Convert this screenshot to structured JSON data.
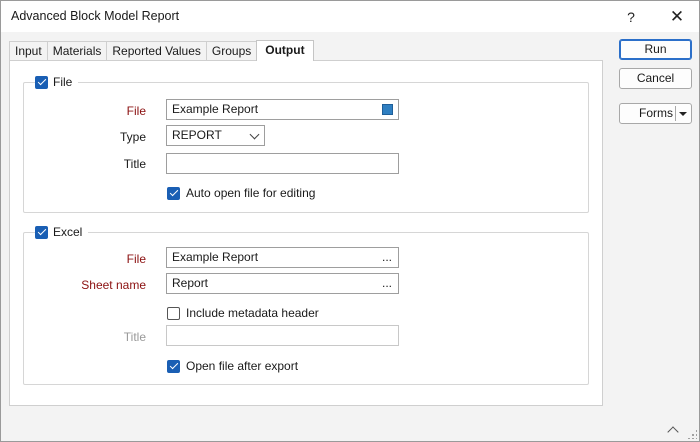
{
  "window": {
    "title": "Advanced Block Model Report",
    "help_label": "?",
    "close_label": "✕"
  },
  "tabs": [
    {
      "label": "Input",
      "active": false
    },
    {
      "label": "Materials",
      "active": false
    },
    {
      "label": "Reported Values",
      "active": false
    },
    {
      "label": "Groups",
      "active": false
    },
    {
      "label": "Output",
      "active": true
    }
  ],
  "file_group": {
    "checkbox_label": "File",
    "checked": true,
    "file_label": "File",
    "file_value": "Example Report",
    "file_icon": "square-file-icon",
    "type_label": "Type",
    "type_value": "REPORT",
    "title_label": "Title",
    "title_value": "",
    "auto_open_label": "Auto open file for editing",
    "auto_open_checked": true
  },
  "excel_group": {
    "checkbox_label": "Excel",
    "checked": true,
    "file_label": "File",
    "file_value": "Example Report",
    "file_browse": "...",
    "sheet_label": "Sheet name",
    "sheet_value": "Report",
    "sheet_browse": "...",
    "metadata_label": "Include metadata header",
    "metadata_checked": false,
    "title_label": "Title",
    "title_value": "",
    "open_after_label": "Open file after export",
    "open_after_checked": true
  },
  "buttons": {
    "run": "Run",
    "cancel": "Cancel",
    "forms": "Forms"
  },
  "colors": {
    "accent": "#1a5fb4",
    "required_label": "#8b1010",
    "file_icon": "#2f7fc1"
  }
}
